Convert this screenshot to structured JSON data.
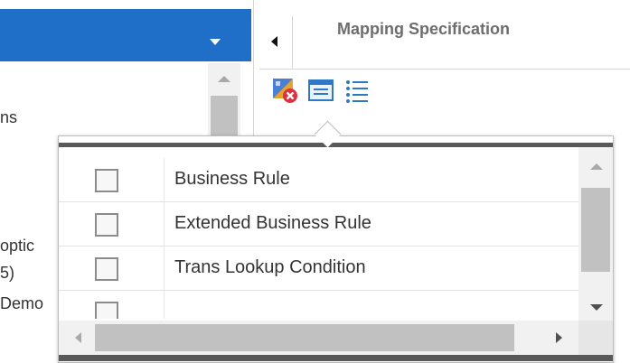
{
  "left_panel": {
    "header_color": "#1f6fc9",
    "text_fragments": [
      "ns",
      "optic",
      "5)",
      "Demo"
    ]
  },
  "right_panel": {
    "title": "Mapping Specification",
    "toolbar_icons": [
      "delete-mapping-icon",
      "window-view-icon",
      "list-view-icon"
    ]
  },
  "popup": {
    "items": [
      {
        "label": "Business Rule",
        "checked": false
      },
      {
        "label": "Extended Business Rule",
        "checked": false
      },
      {
        "label": "Trans Lookup Condition",
        "checked": false
      },
      {
        "label": "",
        "checked": false
      }
    ]
  }
}
